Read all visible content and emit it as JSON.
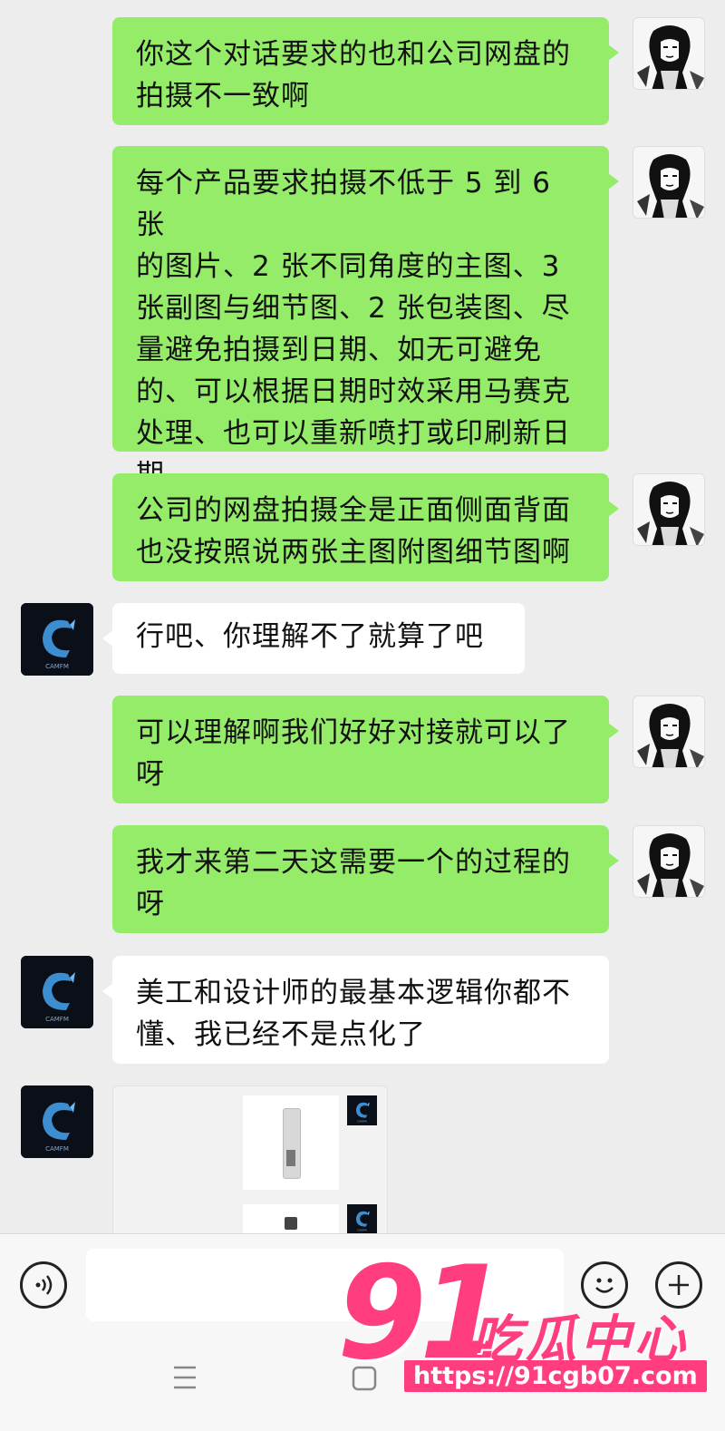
{
  "messages": [
    {
      "lines": [
        "你这个对话要求的也和公司网盘的",
        "拍摄不一致啊"
      ]
    },
    {
      "lines": [
        "每个产品要求拍摄不低于 5 到 6 张",
        "的图片、2 张不同角度的主图、3",
        "张副图与细节图、2 张包装图、尽",
        "量避免拍摄到日期、如无可避免",
        "的、可以根据日期时效采用马赛克",
        "处理、也可以重新喷打或印刷新日",
        "期。"
      ]
    },
    {
      "lines": [
        "公司的网盘拍摄全是正面侧面背面",
        "也没按照说两张主图附图细节图啊"
      ]
    },
    {
      "lines": [
        "行吧、你理解不了就算了吧"
      ]
    },
    {
      "lines": [
        "可以理解啊我们好好对接就可以了",
        "呀"
      ]
    },
    {
      "lines": [
        "我才来第二天这需要一个的过程的",
        "呀"
      ]
    },
    {
      "lines": [
        "美工和设计师的最基本逻辑你都不",
        "懂、我已经不是点化了"
      ]
    }
  ],
  "avatar_brand_text": "CAMFM",
  "watermark": {
    "number": "91",
    "name": "吃瓜中心",
    "url": "https://91cgb07.com"
  },
  "colors": {
    "self_bubble": "#95ec69",
    "other_bubble": "#ffffff",
    "background": "#ededed",
    "watermark": "#ff3d7f"
  },
  "icons": {
    "voice": "voice-icon",
    "emoji": "emoji-icon",
    "plus": "plus-icon",
    "menu": "menu-icon",
    "home": "home-icon"
  }
}
